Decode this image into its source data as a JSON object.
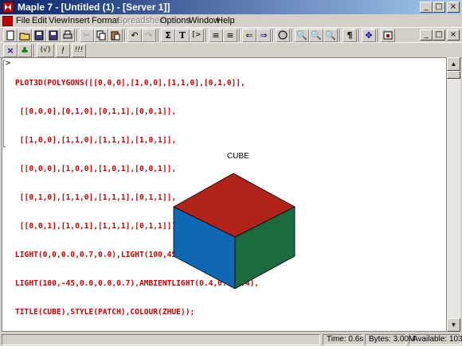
{
  "window": {
    "title": "Maple 7 - [Untitled (1) - [Server 1]]",
    "controls": {
      "minimize": "_",
      "maximize": "□",
      "close": "×"
    }
  },
  "menu": {
    "items": [
      "File",
      "Edit",
      "View",
      "Insert",
      "Format",
      "Spreadsheet",
      "Options",
      "Window",
      "Help"
    ],
    "disabled": [
      "Spreadsheet"
    ]
  },
  "toolbar": {
    "text_button": "T",
    "math_button": "Σ",
    "prompt_button": "[>",
    "paragraph_button": "¶"
  },
  "context_bar": {
    "symbolic_button": "(√)",
    "exclaim_button": "!",
    "multi_exclaim_button": "!!!"
  },
  "worksheet": {
    "prompt": ">",
    "code_lines": [
      "PLOT3D(POLYGONS([[0,0,0],[1,0,0],[1,1,0],[0,1,0]],",
      " [[0,0,0],[0,1,0],[0,1,1],[0,0,1]],",
      " [[1,0,0],[1,1,0],[1,1,1],[1,0,1]],",
      " [[0,0,0],[1,0,0],[1,0,1],[0,0,1]],",
      " [[0,1,0],[1,1,0],[1,1,1],[0,1,1]],",
      " [[0,0,1],[1,0,1],[1,1,1],[0,1,1]]),",
      "LIGHT(0,0,0.0,0.7,0.0),LIGHT(100,45,0.7,0.0,0.0),",
      "LIGHT(100,-45,0.0,0.0,0.7),AMBIENTLIGHT(0.4,0.4,0.4),",
      "TITLE(CUBE),STYLE(PATCH),COLOUR(ZHUE));"
    ],
    "plot_title": "CUBE",
    "cube_colors": {
      "top": "#b2231a",
      "left": "#1067b4",
      "right": "#1b6b3e"
    }
  },
  "status": {
    "time": "Time:   0.6s",
    "bytes": "Bytes: 3.00M",
    "available": "Available: 103M"
  }
}
